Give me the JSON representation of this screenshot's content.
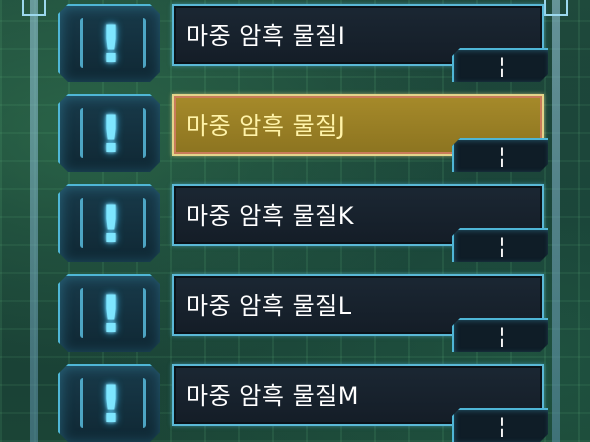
{
  "items": [
    {
      "name": "마중 암흑 물질I",
      "count": "¦",
      "selected": false
    },
    {
      "name": "마중 암흑 물질J",
      "count": "¦",
      "selected": true
    },
    {
      "name": "마중 암흑 물질K",
      "count": "¦",
      "selected": false
    },
    {
      "name": "마중 암흑 물질L",
      "count": "¦",
      "selected": false
    },
    {
      "name": "마중 암흑 물질M",
      "count": "¦",
      "selected": false
    }
  ],
  "alert_icon": "exclamation-icon",
  "colors": {
    "accent": "#5ab8d6",
    "selected_fill": "#a68a2a",
    "selected_text": "#fff3a8",
    "icon_glow": "#7ee6ff"
  }
}
